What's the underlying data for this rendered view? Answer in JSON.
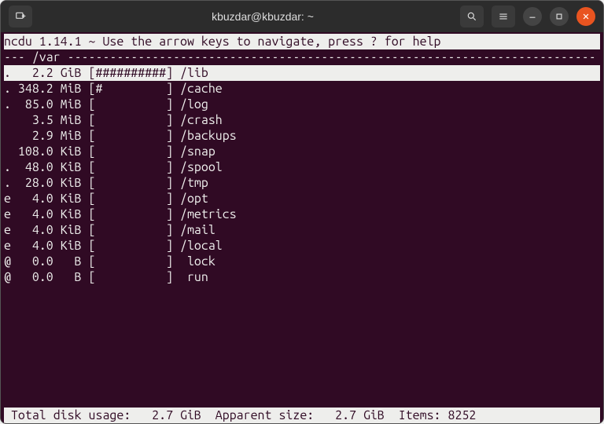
{
  "window": {
    "title": "kbuzdar@kbuzdar: ~"
  },
  "ncdu": {
    "header": "ncdu 1.14.1 ~ Use the arrow keys to navigate, press ? for help",
    "path_prefix": "--- ",
    "path": "/var",
    "path_fill": " ---------------------------------------------------------------------------",
    "entries": [
      {
        "flag": ".",
        "size": "  2.2 GiB",
        "bar": "##########",
        "name": "/lib",
        "selected": true
      },
      {
        "flag": ".",
        "size": "348.2 MiB",
        "bar": "#         ",
        "name": "/cache",
        "selected": false
      },
      {
        "flag": ".",
        "size": " 85.0 MiB",
        "bar": "          ",
        "name": "/log",
        "selected": false
      },
      {
        "flag": " ",
        "size": "  3.5 MiB",
        "bar": "          ",
        "name": "/crash",
        "selected": false
      },
      {
        "flag": " ",
        "size": "  2.9 MiB",
        "bar": "          ",
        "name": "/backups",
        "selected": false
      },
      {
        "flag": " ",
        "size": "108.0 KiB",
        "bar": "          ",
        "name": "/snap",
        "selected": false
      },
      {
        "flag": ".",
        "size": " 48.0 KiB",
        "bar": "          ",
        "name": "/spool",
        "selected": false
      },
      {
        "flag": ".",
        "size": " 28.0 KiB",
        "bar": "          ",
        "name": "/tmp",
        "selected": false
      },
      {
        "flag": "e",
        "size": "  4.0 KiB",
        "bar": "          ",
        "name": "/opt",
        "selected": false
      },
      {
        "flag": "e",
        "size": "  4.0 KiB",
        "bar": "          ",
        "name": "/metrics",
        "selected": false
      },
      {
        "flag": "e",
        "size": "  4.0 KiB",
        "bar": "          ",
        "name": "/mail",
        "selected": false
      },
      {
        "flag": "e",
        "size": "  4.0 KiB",
        "bar": "          ",
        "name": "/local",
        "selected": false
      },
      {
        "flag": "@",
        "size": "  0.0   B",
        "bar": "          ",
        "name": " lock",
        "selected": false
      },
      {
        "flag": "@",
        "size": "  0.0   B",
        "bar": "          ",
        "name": " run",
        "selected": false
      }
    ],
    "footer": " Total disk usage:   2.7 GiB  Apparent size:   2.7 GiB  Items: 8252"
  }
}
